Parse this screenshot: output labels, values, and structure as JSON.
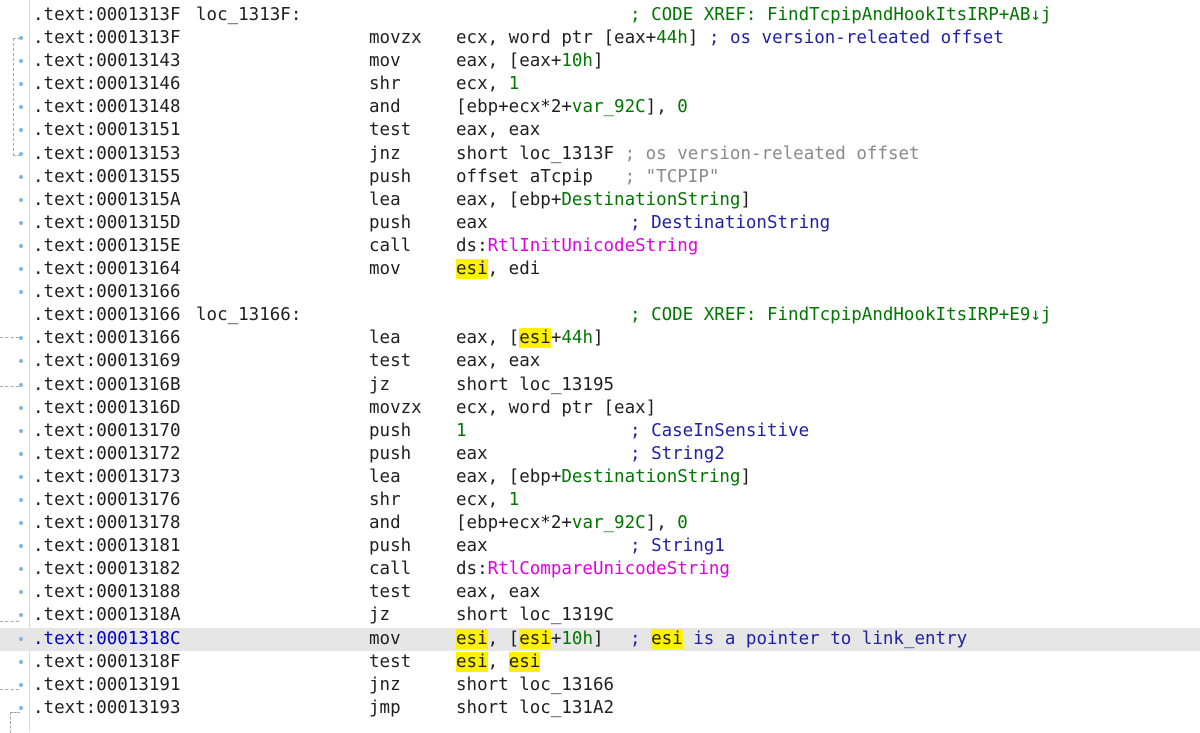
{
  "rows": [
    {
      "address": ".text:0001313F",
      "label": "loc_1313F:",
      "comment": [
        {
          "t": "; CODE XREF: FindTcpipAndHookItsIRP+AB↓j",
          "c": "xref"
        }
      ]
    },
    {
      "address": ".text:0001313F",
      "mnemonic": "movzx",
      "operands": [
        {
          "t": "ecx, word ptr [eax+"
        },
        {
          "t": "44h",
          "c": "num"
        },
        {
          "t": "] "
        },
        {
          "t": "; os version-releated offset",
          "c": "cmt"
        }
      ]
    },
    {
      "address": ".text:00013143",
      "mnemonic": "mov",
      "operands": [
        {
          "t": "eax, [eax+"
        },
        {
          "t": "10h",
          "c": "num"
        },
        {
          "t": "]"
        }
      ]
    },
    {
      "address": ".text:00013146",
      "mnemonic": "shr",
      "operands": [
        {
          "t": "ecx, "
        },
        {
          "t": "1",
          "c": "num"
        }
      ]
    },
    {
      "address": ".text:00013148",
      "mnemonic": "and",
      "operands": [
        {
          "t": "[ebp+ecx*2+"
        },
        {
          "t": "var_92C",
          "c": "name"
        },
        {
          "t": "], "
        },
        {
          "t": "0",
          "c": "num"
        }
      ]
    },
    {
      "address": ".text:00013151",
      "mnemonic": "test",
      "operands": [
        {
          "t": "eax, eax"
        }
      ]
    },
    {
      "address": ".text:00013153",
      "mnemonic": "jnz",
      "operands": [
        {
          "t": "short loc_1313F "
        },
        {
          "t": "; os version-releated offset",
          "c": "acmt"
        }
      ]
    },
    {
      "address": ".text:00013155",
      "mnemonic": "push",
      "operands": [
        {
          "t": "offset aTcpip   "
        },
        {
          "t": "; \"TCPIP\"",
          "c": "strc"
        }
      ]
    },
    {
      "address": ".text:0001315A",
      "mnemonic": "lea",
      "operands": [
        {
          "t": "eax, [ebp+"
        },
        {
          "t": "DestinationString",
          "c": "name"
        },
        {
          "t": "]"
        }
      ]
    },
    {
      "address": ".text:0001315D",
      "mnemonic": "push",
      "operands": [
        {
          "t": "eax"
        }
      ],
      "comment": [
        {
          "t": "; DestinationString",
          "c": "cmt"
        }
      ]
    },
    {
      "address": ".text:0001315E",
      "mnemonic": "call",
      "operands": [
        {
          "t": "ds:"
        },
        {
          "t": "RtlInitUnicodeString",
          "c": "imp"
        }
      ]
    },
    {
      "address": ".text:00013164",
      "mnemonic": "mov",
      "operands": [
        {
          "t": "esi",
          "c": "hl"
        },
        {
          "t": ", edi"
        }
      ]
    },
    {
      "address": ".text:00013166"
    },
    {
      "address": ".text:00013166",
      "label": "loc_13166:",
      "comment": [
        {
          "t": "; CODE XREF: FindTcpipAndHookItsIRP+E9↓j",
          "c": "xref"
        }
      ]
    },
    {
      "address": ".text:00013166",
      "mnemonic": "lea",
      "operands": [
        {
          "t": "eax, ["
        },
        {
          "t": "esi",
          "c": "hl"
        },
        {
          "t": "+"
        },
        {
          "t": "44h",
          "c": "num"
        },
        {
          "t": "]"
        }
      ]
    },
    {
      "address": ".text:00013169",
      "mnemonic": "test",
      "operands": [
        {
          "t": "eax, eax"
        }
      ]
    },
    {
      "address": ".text:0001316B",
      "mnemonic": "jz",
      "operands": [
        {
          "t": "short loc_13195"
        }
      ]
    },
    {
      "address": ".text:0001316D",
      "mnemonic": "movzx",
      "operands": [
        {
          "t": "ecx, word ptr [eax]"
        }
      ]
    },
    {
      "address": ".text:00013170",
      "mnemonic": "push",
      "operands": [
        {
          "t": "1",
          "c": "num"
        }
      ],
      "comment": [
        {
          "t": "; CaseInSensitive",
          "c": "cmt"
        }
      ]
    },
    {
      "address": ".text:00013172",
      "mnemonic": "push",
      "operands": [
        {
          "t": "eax"
        }
      ],
      "comment": [
        {
          "t": "; String2",
          "c": "cmt"
        }
      ]
    },
    {
      "address": ".text:00013173",
      "mnemonic": "lea",
      "operands": [
        {
          "t": "eax, [ebp+"
        },
        {
          "t": "DestinationString",
          "c": "name"
        },
        {
          "t": "]"
        }
      ]
    },
    {
      "address": ".text:00013176",
      "mnemonic": "shr",
      "operands": [
        {
          "t": "ecx, "
        },
        {
          "t": "1",
          "c": "num"
        }
      ]
    },
    {
      "address": ".text:00013178",
      "mnemonic": "and",
      "operands": [
        {
          "t": "[ebp+ecx*2+"
        },
        {
          "t": "var_92C",
          "c": "name"
        },
        {
          "t": "], "
        },
        {
          "t": "0",
          "c": "num"
        }
      ]
    },
    {
      "address": ".text:00013181",
      "mnemonic": "push",
      "operands": [
        {
          "t": "eax"
        }
      ],
      "comment": [
        {
          "t": "; String1",
          "c": "cmt"
        }
      ]
    },
    {
      "address": ".text:00013182",
      "mnemonic": "call",
      "operands": [
        {
          "t": "ds:"
        },
        {
          "t": "RtlCompareUnicodeString",
          "c": "imp"
        }
      ]
    },
    {
      "address": ".text:00013188",
      "mnemonic": "test",
      "operands": [
        {
          "t": "eax, eax"
        }
      ]
    },
    {
      "address": ".text:0001318A",
      "mnemonic": "jz",
      "operands": [
        {
          "t": "short loc_1319C"
        }
      ]
    },
    {
      "address": ".text:0001318C",
      "mnemonic": "mov",
      "selected": true,
      "operands": [
        {
          "t": "esi",
          "c": "hl"
        },
        {
          "t": ", ["
        },
        {
          "t": "esi",
          "c": "hl"
        },
        {
          "t": "+"
        },
        {
          "t": "10h",
          "c": "num"
        },
        {
          "t": "]"
        }
      ],
      "comment": [
        {
          "t": "; ",
          "c": "cmt"
        },
        {
          "t": "esi",
          "c": "hl"
        },
        {
          "t": " is a pointer to link_entry",
          "c": "cmt"
        }
      ]
    },
    {
      "address": ".text:0001318F",
      "mnemonic": "test",
      "operands": [
        {
          "t": "esi",
          "c": "hl"
        },
        {
          "t": ", "
        },
        {
          "t": "esi",
          "c": "hl"
        }
      ]
    },
    {
      "address": ".text:00013191",
      "mnemonic": "jnz",
      "operands": [
        {
          "t": "short loc_13166"
        }
      ]
    },
    {
      "address": ".text:00013193",
      "mnemonic": "jmp",
      "operands": [
        {
          "t": "short loc_131A2"
        }
      ]
    }
  ]
}
